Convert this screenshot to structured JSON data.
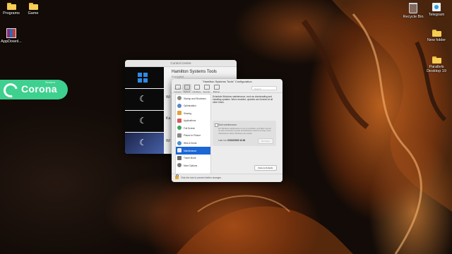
{
  "desktop": {
    "icons_left": [
      {
        "label": "Programs",
        "icon": "folder-icon"
      },
      {
        "label": "Game",
        "icon": "folder-icon"
      },
      {
        "label": "AppDownl...",
        "icon": "winrar-archive-icon"
      }
    ],
    "icons_right": [
      {
        "label": "Recycle Bin",
        "icon": "recycle-bin-icon"
      },
      {
        "label": "Telegram",
        "icon": "telegram-icon"
      },
      {
        "label": "New folder",
        "icon": "folder-icon"
      },
      {
        "label": "Parallels Desktop 19",
        "icon": "folder-icon"
      }
    ]
  },
  "corona_badge": {
    "text": "Corona",
    "small": "Renderer",
    "color": "#3ed08e"
  },
  "back_window": {
    "title": "Control Centre",
    "heading": "Hamilton Systems Tools",
    "subheading": "Encrypted",
    "fragments": [
      "Wi",
      "Ka",
      "Wi"
    ]
  },
  "front_window": {
    "title": "\"Hamilton Systems Tools\" Configuration",
    "toolbar": [
      "General",
      "System",
      "Hardware",
      "Security",
      "Backup"
    ],
    "active_tab": "System",
    "search_placeholder": "Search",
    "sidebar": [
      "Startup and Shutdown",
      "Optimization",
      "Sharing",
      "Applications",
      "Full Screen",
      "Picture in Picture",
      "Web & Email",
      "Maintenance",
      "Travel Mode",
      "More Options"
    ],
    "selected_item": "Maintenance",
    "description": "Schedule Windows maintenance, such as downloading and installing updates. When enabled, updates are blocked at all other times.",
    "checkbox_label": "Start maintenance:",
    "note": "For Windows maintenance to run on schedule, your Mac must be on and connected to power and Windows must be running. Once maintenance starts, Windows may restart.",
    "last_run_label": "Last run:",
    "last_run_value": "02/12/2023 11:54",
    "run_now": "Run Now",
    "restore_button": "Restore Defaults",
    "lock_text": "Click the lock to prevent further changes."
  },
  "colors": {
    "selection": "#1c66d6",
    "badge": "#3ed08e"
  }
}
